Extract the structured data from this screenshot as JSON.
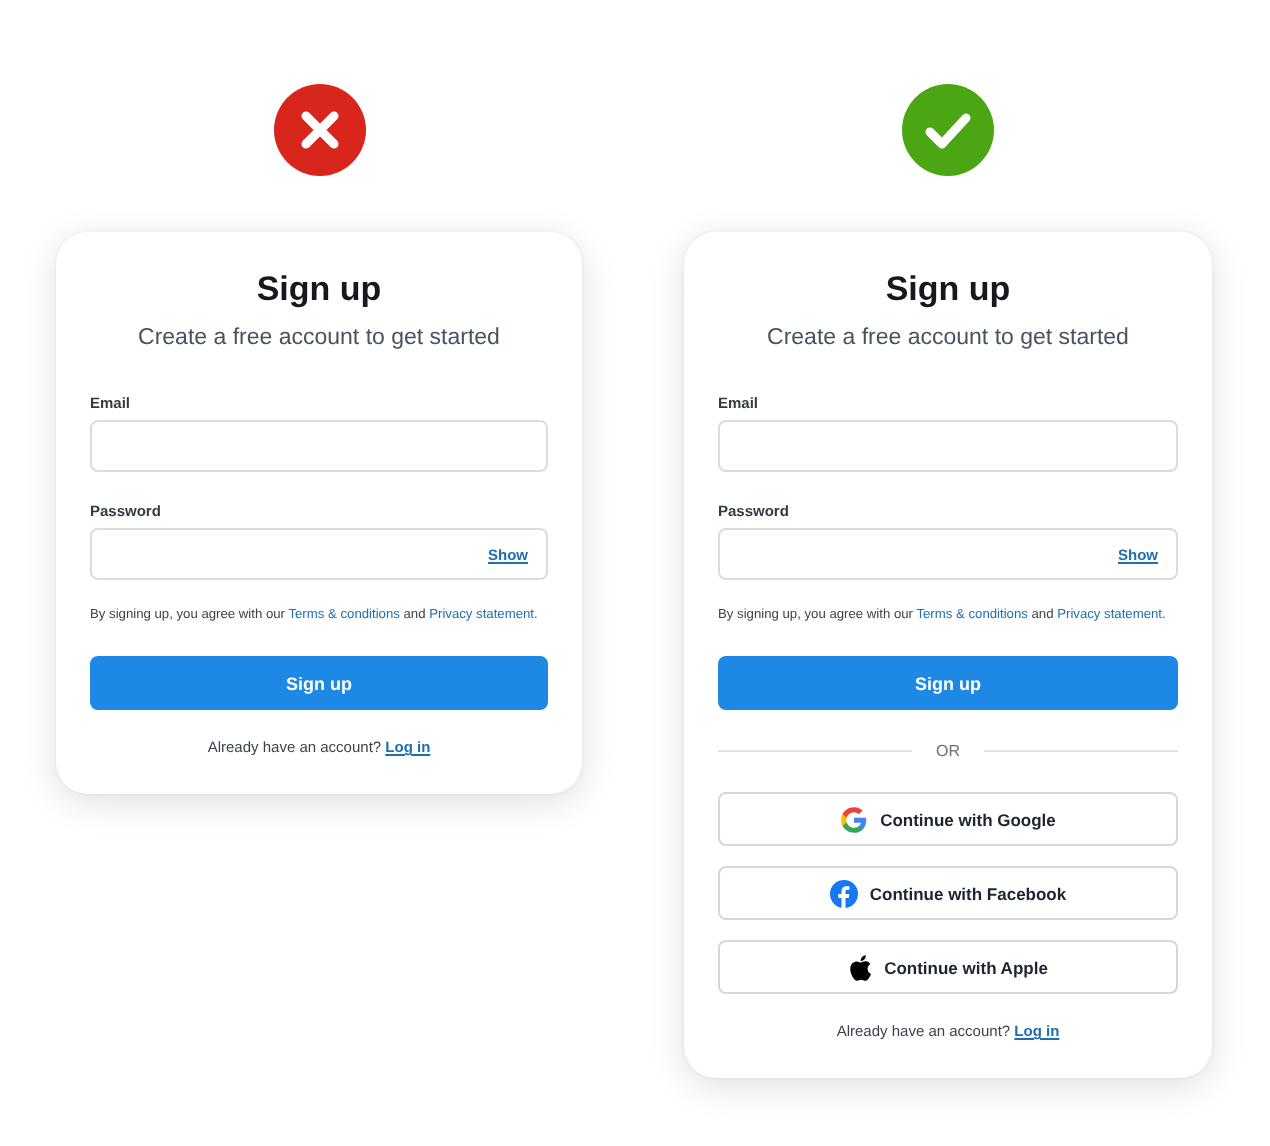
{
  "panels": [
    {
      "kind": "bad",
      "title": "Sign up",
      "subtitle": "Create a free account to get started",
      "fields": [
        {
          "label": "Email"
        },
        {
          "label": "Password",
          "action": "Show"
        }
      ],
      "terms": [
        {
          "kind": "text",
          "text": "By signing up, you agree with our "
        },
        {
          "kind": "link",
          "text": "Terms & conditions"
        },
        {
          "kind": "text",
          "text": " and "
        },
        {
          "kind": "link",
          "text": "Privacy statement."
        }
      ],
      "submit": "Sign up",
      "login": {
        "text": "Already have an account?",
        "link": "Log in"
      }
    },
    {
      "kind": "good",
      "title": "Sign up",
      "subtitle": "Create a free account to get started",
      "fields": [
        {
          "label": "Email"
        },
        {
          "label": "Password",
          "action": "Show"
        }
      ],
      "terms": [
        {
          "kind": "text",
          "text": "By signing up, you agree with our "
        },
        {
          "kind": "link",
          "text": "Terms & conditions"
        },
        {
          "kind": "text",
          "text": " and "
        },
        {
          "kind": "link",
          "text": "Privacy statement."
        }
      ],
      "submit": "Sign up",
      "divider": "OR",
      "social": [
        {
          "kind": "google",
          "label": "Continue with Google"
        },
        {
          "kind": "facebook",
          "label": "Continue with Facebook"
        },
        {
          "kind": "apple",
          "label": "Continue with Apple"
        }
      ],
      "login": {
        "text": "Already have an account?",
        "link": "Log in"
      }
    }
  ]
}
